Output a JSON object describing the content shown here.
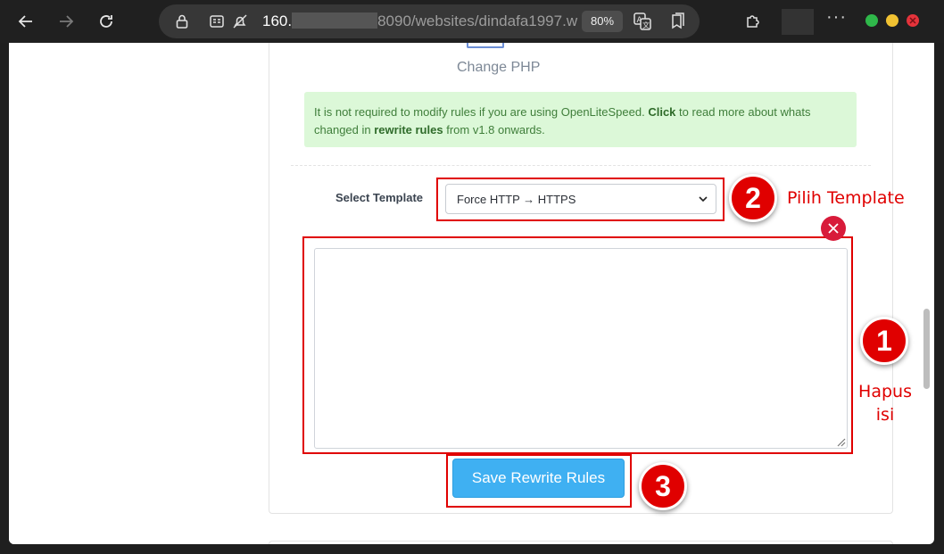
{
  "browser": {
    "url_host": "160.",
    "url_port_path": "8090/websites/dindafa1997.w",
    "zoom": "80%"
  },
  "page": {
    "change_php_label": "Change PHP",
    "alert": {
      "text_1": "It is not required to modify rules if you are using OpenLiteSpeed.",
      "click": "Click",
      "text_2": "to read more about whats changed in",
      "rewrite_rules": "rewrite rules",
      "text_3": "from v1.8 onwards."
    },
    "select_template_label": "Select Template",
    "template_selected": "Force HTTP → HTTPS",
    "textarea_value": "",
    "save_button": "Save Rewrite Rules"
  },
  "annotations": {
    "step_1": "1",
    "step_1_label_line1": "Hapus",
    "step_1_label_line2": "isi",
    "step_2": "2",
    "step_2_label": "Pilih Template",
    "step_3": "3"
  },
  "colors": {
    "annotation_red": "#e00000",
    "button_blue": "#3fb0f2",
    "alert_bg": "#dcf8d8",
    "alert_text": "#3f7e3a"
  }
}
